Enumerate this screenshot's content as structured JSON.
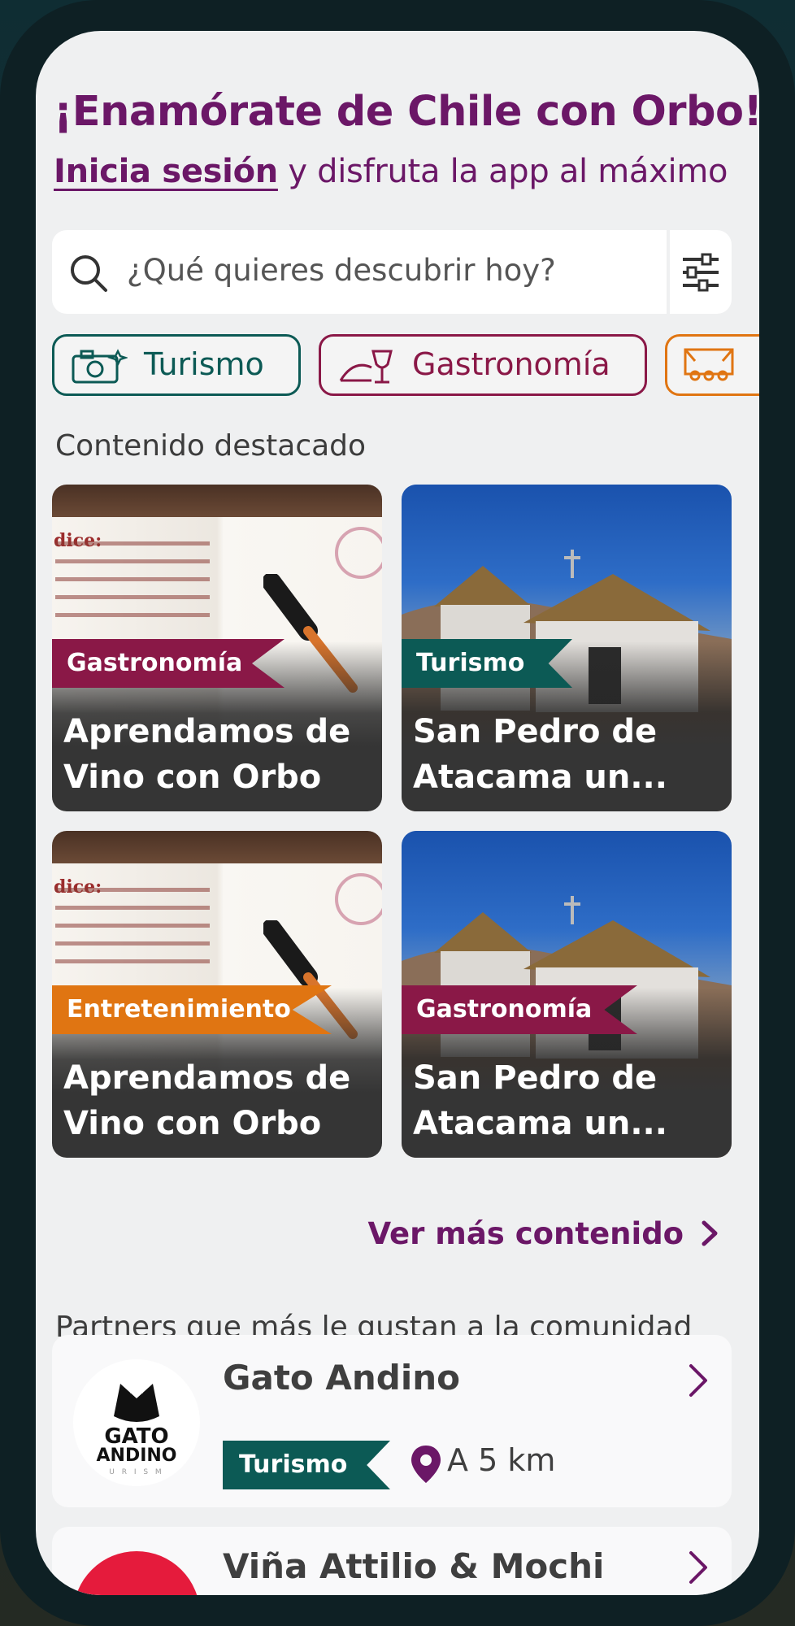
{
  "header": {
    "headline": "¡Enamórate de Chile con Orbo!",
    "login_link": "Inicia sesión",
    "login_suffix": " y disfruta la app al máximo"
  },
  "search": {
    "placeholder": "¿Qué quieres descubrir hoy?",
    "search_icon": "search-icon",
    "filter_icon": "sliders-icon"
  },
  "categories": [
    {
      "label": "Turismo",
      "icon": "camera-icon",
      "color": "#0c5a55"
    },
    {
      "label": "Gastronomía",
      "icon": "dish-wine-icon",
      "color": "#8a1847"
    },
    {
      "label": "",
      "icon": "theater-seats-icon",
      "color": "#e07512"
    }
  ],
  "featured": {
    "title": "Contenido destacado",
    "cards": [
      {
        "tag": "Gastronomía",
        "tag_color": "#8a1847",
        "title_line1": "Aprendamos de",
        "title_line2": "Vino con Orbo",
        "image": "wine-book"
      },
      {
        "tag": "Turismo",
        "tag_color": "#0c5a55",
        "title_line1": "San Pedro de",
        "title_line2": "Atacama un...",
        "image": "adobe-church"
      },
      {
        "tag": "Entretenimiento",
        "tag_color": "#e07512",
        "title_line1": "Aprendamos de",
        "title_line2": "Vino con Orbo",
        "image": "wine-book"
      },
      {
        "tag": "Gastronomía",
        "tag_color": "#8a1847",
        "title_line1": "San Pedro de",
        "title_line2": "Atacama un...",
        "image": "adobe-church"
      }
    ],
    "more_label": "Ver más contenido"
  },
  "partners": {
    "title": "Partners que más le gustan a la comunidad",
    "items": [
      {
        "name": "Gato Andino",
        "tag": "Turismo",
        "distance": "A 5 km",
        "logo_text_1": "GATO",
        "logo_text_2": "ANDINO",
        "logo_text_3": "U R I S M"
      },
      {
        "name": "Viña Attilio & Mochi"
      }
    ]
  },
  "colors": {
    "brand_purple": "#6b1767",
    "turismo": "#0c5a55",
    "gastronomia": "#8a1847",
    "entretenimiento": "#e07512"
  }
}
